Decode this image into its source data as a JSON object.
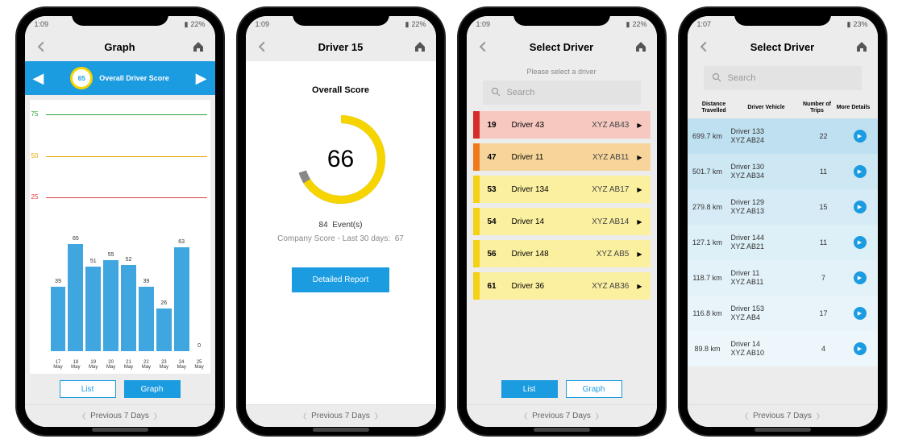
{
  "status": {
    "time_a": "1:09",
    "time_b": "1:07",
    "battery_a": "22%",
    "battery_b": "23%"
  },
  "footer": {
    "label": "Previous 7 Days"
  },
  "toggles": {
    "list": "List",
    "graph": "Graph"
  },
  "search_placeholder": "Search",
  "phone1": {
    "title": "Graph",
    "score_value": "65",
    "score_label": "Overall Driver Score"
  },
  "chart_data": {
    "type": "bar",
    "categories": [
      "17 May",
      "18 May",
      "19 May",
      "20 May",
      "21 May",
      "22 May",
      "23 May",
      "24 May",
      "25 May"
    ],
    "values": [
      39,
      65,
      51,
      55,
      52,
      39,
      26,
      63,
      0
    ],
    "yticks": [
      25,
      50,
      75
    ],
    "ytick_colors": [
      "#e04040",
      "#e6a800",
      "#2aa33a"
    ],
    "ylim": [
      0,
      80
    ],
    "title": "Overall Driver Score",
    "xlabel": "",
    "ylabel": ""
  },
  "phone2": {
    "title": "Driver 15",
    "heading": "Overall Score",
    "score": "66",
    "events_count": "84",
    "events_suffix": "Event(s)",
    "company_prefix": "Company Score - Last 30 days:",
    "company_val": "67",
    "button": "Detailed Report"
  },
  "phone3": {
    "title": "Select Driver",
    "prompt": "Please select a driver",
    "rows": [
      {
        "score": "19",
        "name": "Driver 43",
        "vehicle": "XYZ AB43",
        "stripe": "#d62c2c",
        "bg": "#f7c8c0"
      },
      {
        "score": "47",
        "name": "Driver 11",
        "vehicle": "XYZ AB11",
        "stripe": "#ef7a1a",
        "bg": "#f7d59a"
      },
      {
        "score": "53",
        "name": "Driver 134",
        "vehicle": "XYZ AB17",
        "stripe": "#f4d016",
        "bg": "#fbf0a0"
      },
      {
        "score": "54",
        "name": "Driver 14",
        "vehicle": "XYZ AB14",
        "stripe": "#f4d016",
        "bg": "#fbf0a0"
      },
      {
        "score": "56",
        "name": "Driver 148",
        "vehicle": "XYZ AB5",
        "stripe": "#f4d016",
        "bg": "#fbf0a0"
      },
      {
        "score": "61",
        "name": "Driver 36",
        "vehicle": "XYZ AB36",
        "stripe": "#f4d016",
        "bg": "#fbf0a0"
      }
    ]
  },
  "phone4": {
    "title": "Select Driver",
    "headers": {
      "dist": "Distance Travelled",
      "drv": "Driver Vehicle",
      "trips": "Number of Trips",
      "more": "More Details"
    },
    "rows": [
      {
        "dist": "699.7 km",
        "driver": "Driver 133",
        "vehicle": "XYZ AB24",
        "trips": "22",
        "bg": "#bfe0f0"
      },
      {
        "dist": "501.7 km",
        "driver": "Driver 130",
        "vehicle": "XYZ AB34",
        "trips": "11",
        "bg": "#cde7f3"
      },
      {
        "dist": "279.8 km",
        "driver": "Driver 129",
        "vehicle": "XYZ AB13",
        "trips": "15",
        "bg": "#d6ebf5"
      },
      {
        "dist": "127.1 km",
        "driver": "Driver 144",
        "vehicle": "XYZ AB21",
        "trips": "11",
        "bg": "#ddeff7"
      },
      {
        "dist": "118.7 km",
        "driver": "Driver 11",
        "vehicle": "XYZ AB11",
        "trips": "7",
        "bg": "#e3f2f8"
      },
      {
        "dist": "116.8 km",
        "driver": "Driver 153",
        "vehicle": "XYZ AB4",
        "trips": "17",
        "bg": "#e8f4fa"
      },
      {
        "dist": "89.8 km",
        "driver": "Driver 14",
        "vehicle": "XYZ AB10",
        "trips": "4",
        "bg": "#edf7fb"
      }
    ]
  }
}
